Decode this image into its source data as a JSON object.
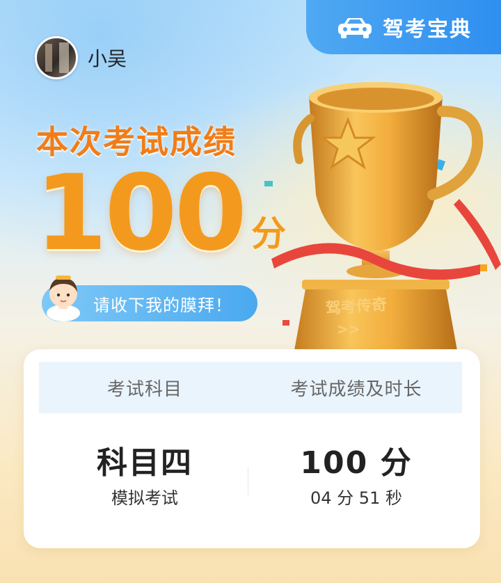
{
  "brand": {
    "name": "驾考宝典",
    "icon": "car-icon"
  },
  "user": {
    "name": "小吴",
    "avatar": "avatar"
  },
  "result": {
    "title": "本次考试成绩",
    "score": "100",
    "unit": "分",
    "cheer": "请收下我的膜拜！"
  },
  "trophy": {
    "plate_text": "驾考传奇",
    "plate_arrows": ">>"
  },
  "table": {
    "headers": [
      "考试科目",
      "考试成绩及时长"
    ],
    "subject": "科目四",
    "subject_type": "模拟考试",
    "score": "100 分",
    "duration": "04 分 51 秒"
  },
  "colors": {
    "accent": "#f39a1e",
    "brand_blue": "#2f8ff0",
    "ribbon": "#e8463c"
  }
}
